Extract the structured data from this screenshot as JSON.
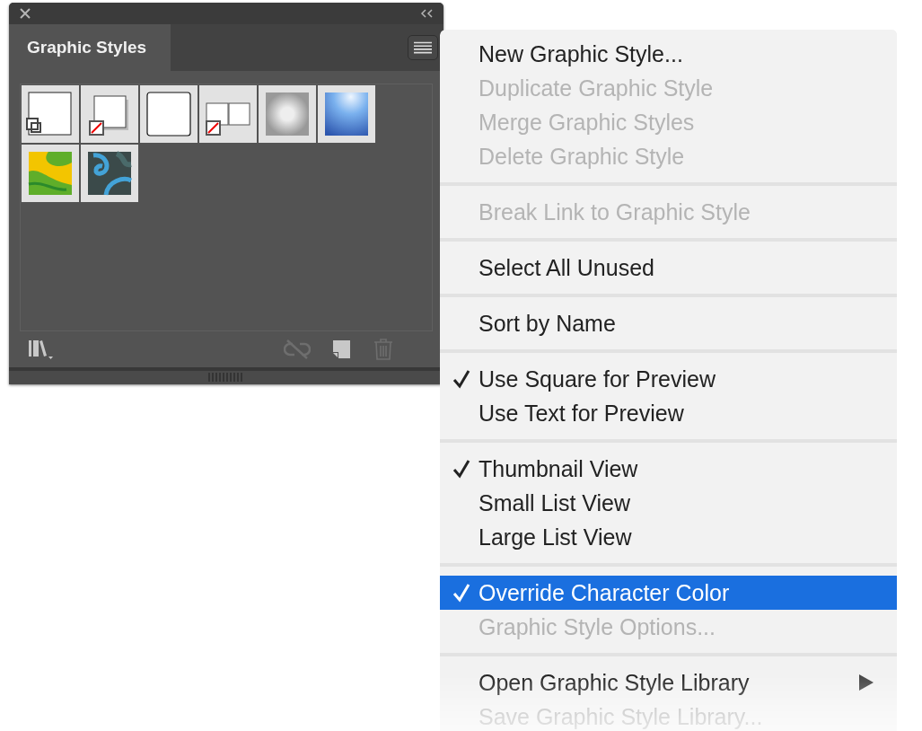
{
  "panel": {
    "tab": {
      "label": "Graphic Styles",
      "selected": true
    },
    "swatches": [
      {
        "kind": "default"
      },
      {
        "kind": "shadow"
      },
      {
        "kind": "rounded"
      },
      {
        "kind": "double"
      },
      {
        "kind": "soft"
      },
      {
        "kind": "glow"
      },
      {
        "kind": "green-swirl"
      },
      {
        "kind": "blue-swirl"
      }
    ],
    "toolbar": [
      {
        "kind": "library",
        "disabled": false
      },
      {
        "kind": "break-link",
        "disabled": true
      },
      {
        "kind": "new",
        "disabled": false
      },
      {
        "kind": "delete",
        "disabled": true
      }
    ]
  },
  "menu": {
    "groups": [
      [
        {
          "label": "New Graphic Style...",
          "disabled": false,
          "checked": false,
          "selected": false
        },
        {
          "label": "Duplicate Graphic Style",
          "disabled": true,
          "checked": false,
          "selected": false
        },
        {
          "label": "Merge Graphic Styles",
          "disabled": true,
          "checked": false,
          "selected": false
        },
        {
          "label": "Delete Graphic Style",
          "disabled": true,
          "checked": false,
          "selected": false
        }
      ],
      [
        {
          "label": "Break Link to Graphic Style",
          "disabled": true,
          "checked": false,
          "selected": false
        }
      ],
      [
        {
          "label": "Select All Unused",
          "disabled": false,
          "checked": false,
          "selected": false
        }
      ],
      [
        {
          "label": "Sort by Name",
          "disabled": false,
          "checked": false,
          "selected": false
        }
      ],
      [
        {
          "label": "Use Square for Preview",
          "disabled": false,
          "checked": true,
          "selected": false
        },
        {
          "label": "Use Text for Preview",
          "disabled": false,
          "checked": false,
          "selected": false
        }
      ],
      [
        {
          "label": "Thumbnail View",
          "disabled": false,
          "checked": true,
          "selected": false
        },
        {
          "label": "Small List View",
          "disabled": false,
          "checked": false,
          "selected": false
        },
        {
          "label": "Large List View",
          "disabled": false,
          "checked": false,
          "selected": false
        }
      ],
      [
        {
          "label": "Override Character Color",
          "disabled": false,
          "checked": true,
          "selected": true
        },
        {
          "label": "Graphic Style Options...",
          "disabled": true,
          "checked": false,
          "selected": false
        }
      ],
      [
        {
          "label": "Open Graphic Style Library",
          "disabled": false,
          "checked": false,
          "selected": false,
          "submenu": true
        },
        {
          "label": "Save Graphic Style Library...",
          "disabled": true,
          "checked": false,
          "selected": false
        }
      ]
    ]
  }
}
